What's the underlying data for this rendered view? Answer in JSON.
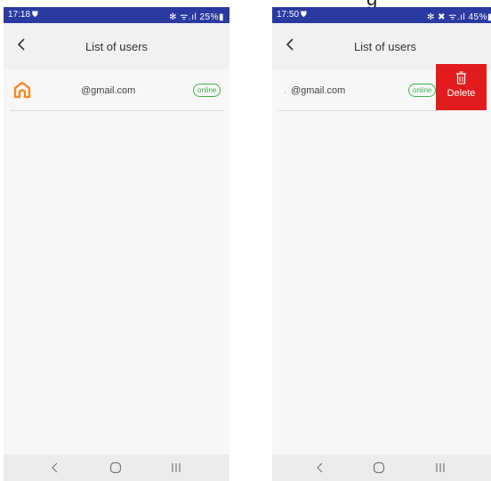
{
  "caption": {
    "fragment": "g"
  },
  "left_screen": {
    "status_bar": {
      "time": "17:18",
      "right_status": "✻ ᯤ.ıl 25%▮"
    },
    "header": {
      "title": "List of users"
    },
    "user_row": {
      "email": "@gmail.com",
      "status": "online"
    }
  },
  "right_screen": {
    "status_bar": {
      "time": "17:50",
      "right_status": "✻ ✖ ᯤ.ıl 45%▮"
    },
    "header": {
      "title": "List of users"
    },
    "user_row": {
      "prefix": ".",
      "email": "@gmail.com",
      "status": "online"
    },
    "delete_action": {
      "label": "Delete"
    }
  },
  "colors": {
    "status_bar": "#2b3aa0",
    "online_green": "#3cb34a",
    "delete_red": "#e21c1c",
    "logo_orange": "#f28c28"
  },
  "icons": {
    "back": "chevron-left-icon",
    "logo": "house-logo-icon",
    "delete": "trash-icon",
    "nav_back": "chevron-left-icon",
    "nav_home": "circle-home-icon",
    "nav_recents": "recents-icon"
  }
}
